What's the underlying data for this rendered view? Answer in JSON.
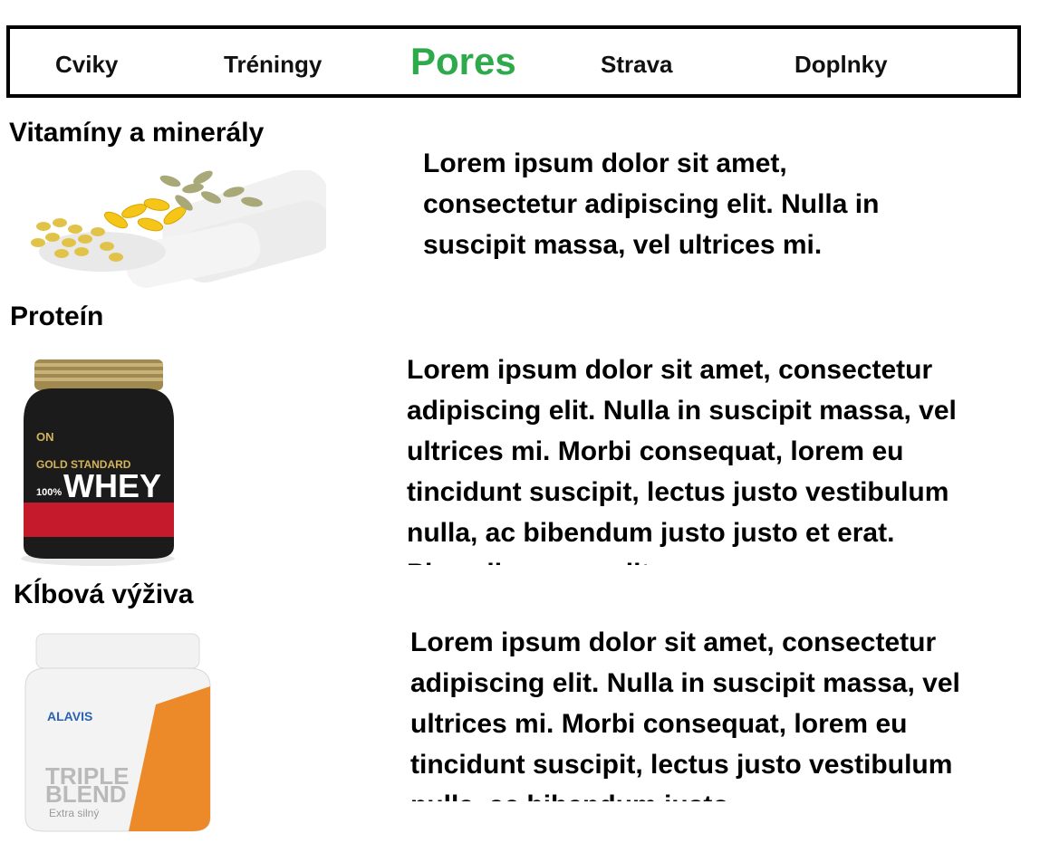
{
  "nav": {
    "items": [
      {
        "label": "Cviky"
      },
      {
        "label": "Tréningy"
      },
      {
        "label": "Pores"
      },
      {
        "label": "Strava"
      },
      {
        "label": "Doplnky"
      }
    ],
    "active_color": "#2eaa4a"
  },
  "sections": [
    {
      "title": "Vitamíny a minerály",
      "image_icon": "vitamin-pills-image",
      "text": "Lorem ipsum dolor sit amet, consectetur adipiscing elit. Nulla in suscipit massa, vel ultrices mi. Morbi consequat, lorem eu tincidunt suscipit, lectus justo vestibulum nulla, ac bibendum justo justo et erat."
    },
    {
      "title": "Proteín",
      "image_icon": "whey-protein-tub-image",
      "image_brand": "ON",
      "image_label_top": "GOLD STANDARD",
      "image_label_main": "WHEY",
      "image_label_prefix": "100%",
      "text": "Lorem ipsum dolor sit amet, consectetur adipiscing elit. Nulla in suscipit massa, vel ultrices mi. Morbi consequat, lorem eu tincidunt suscipit, lectus justo vestibulum nulla, ac bibendum justo justo et erat. Phasellus nec velit."
    },
    {
      "title": "Kĺbová výživa",
      "image_icon": "joint-supplement-tub-image",
      "image_brand": "ALAVIS",
      "image_label_main1": "TRIPLE",
      "image_label_main2": "BLEND",
      "image_label_sub": "Extra silný",
      "text": "Lorem ipsum dolor sit amet, consectetur adipiscing elit. Nulla in suscipit massa, vel ultrices mi. Morbi consequat, lorem eu tincidunt suscipit, lectus justo vestibulum nulla, ac bibendum justo."
    }
  ]
}
